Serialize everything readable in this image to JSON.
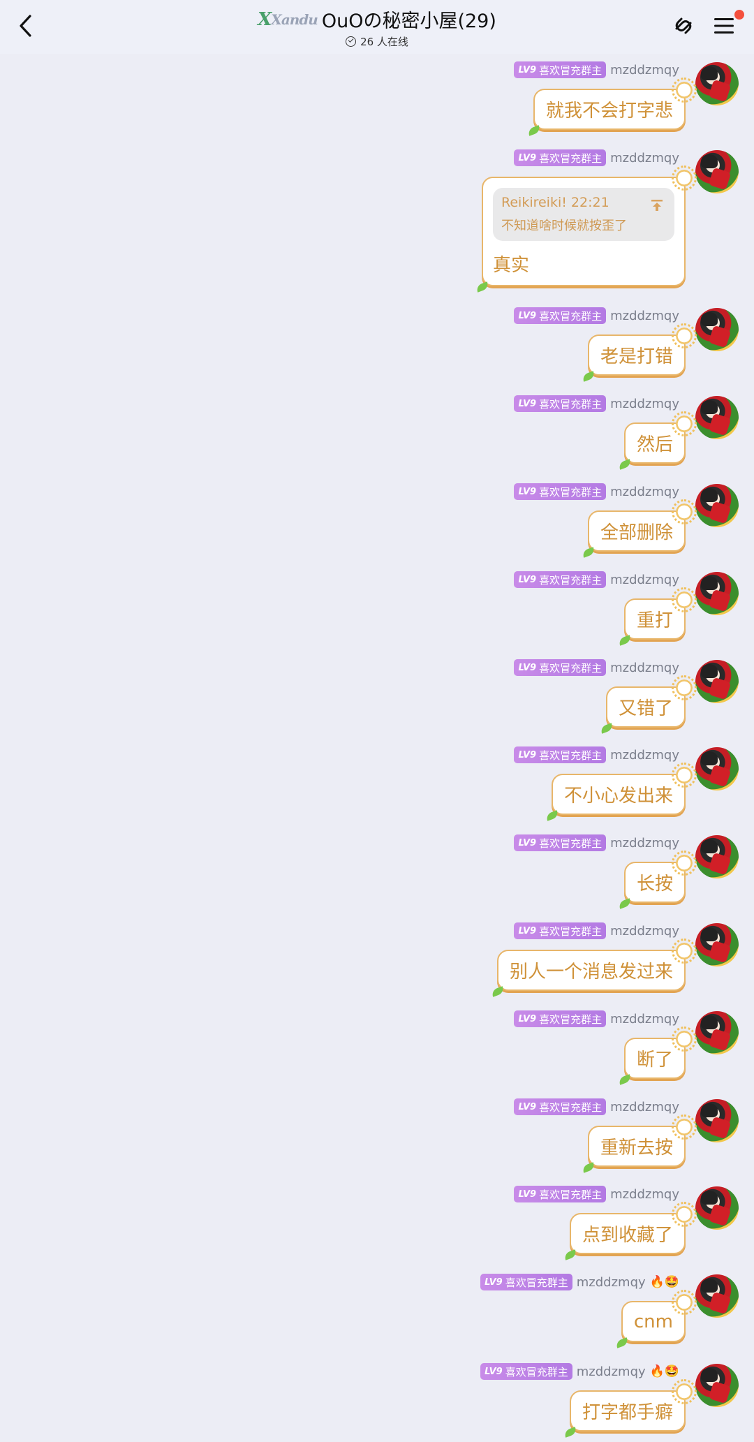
{
  "header": {
    "logo_text": "Xandu",
    "title": "OuOの秘密小屋(29)",
    "online": "26 人在线"
  },
  "messages": [
    {
      "user": "mzddzmqy",
      "badge_level": "LV9",
      "badge_title": "喜欢冒充群主",
      "text": "就我不会打字悲"
    },
    {
      "user": "mzddzmqy",
      "badge_level": "LV9",
      "badge_title": "喜欢冒充群主",
      "reply": {
        "quoted_user": "Reikireiki!",
        "quoted_time": "22:21",
        "quoted_text": "不知道啥时候就按歪了"
      },
      "text": "真实"
    },
    {
      "user": "mzddzmqy",
      "badge_level": "LV9",
      "badge_title": "喜欢冒充群主",
      "text": "老是打错"
    },
    {
      "user": "mzddzmqy",
      "badge_level": "LV9",
      "badge_title": "喜欢冒充群主",
      "text": "然后"
    },
    {
      "user": "mzddzmqy",
      "badge_level": "LV9",
      "badge_title": "喜欢冒充群主",
      "text": "全部删除"
    },
    {
      "user": "mzddzmqy",
      "badge_level": "LV9",
      "badge_title": "喜欢冒充群主",
      "text": "重打"
    },
    {
      "user": "mzddzmqy",
      "badge_level": "LV9",
      "badge_title": "喜欢冒充群主",
      "text": "又错了"
    },
    {
      "user": "mzddzmqy",
      "badge_level": "LV9",
      "badge_title": "喜欢冒充群主",
      "text": "不小心发出来"
    },
    {
      "user": "mzddzmqy",
      "badge_level": "LV9",
      "badge_title": "喜欢冒充群主",
      "text": "长按"
    },
    {
      "user": "mzddzmqy",
      "badge_level": "LV9",
      "badge_title": "喜欢冒充群主",
      "text": "别人一个消息发过来"
    },
    {
      "user": "mzddzmqy",
      "badge_level": "LV9",
      "badge_title": "喜欢冒充群主",
      "text": "断了"
    },
    {
      "user": "mzddzmqy",
      "badge_level": "LV9",
      "badge_title": "喜欢冒充群主",
      "text": "重新去按"
    },
    {
      "user": "mzddzmqy",
      "badge_level": "LV9",
      "badge_title": "喜欢冒充群主",
      "text": "点到收藏了"
    },
    {
      "user": "mzddzmqy",
      "badge_level": "LV9",
      "badge_title": "喜欢冒充群主",
      "user_emojis": "🔥🤩",
      "text": "cnm"
    },
    {
      "user": "mzddzmqy",
      "badge_level": "LV9",
      "badge_title": "喜欢冒充群主",
      "user_emojis": "🔥🤩",
      "text": "打字都手癖"
    }
  ],
  "colors": {
    "background": "#ecedf5",
    "bubble_border": "#e8b66a",
    "bubble_text": "#cf9138",
    "badge": "#c88be8",
    "notification": "#f44f3d"
  }
}
